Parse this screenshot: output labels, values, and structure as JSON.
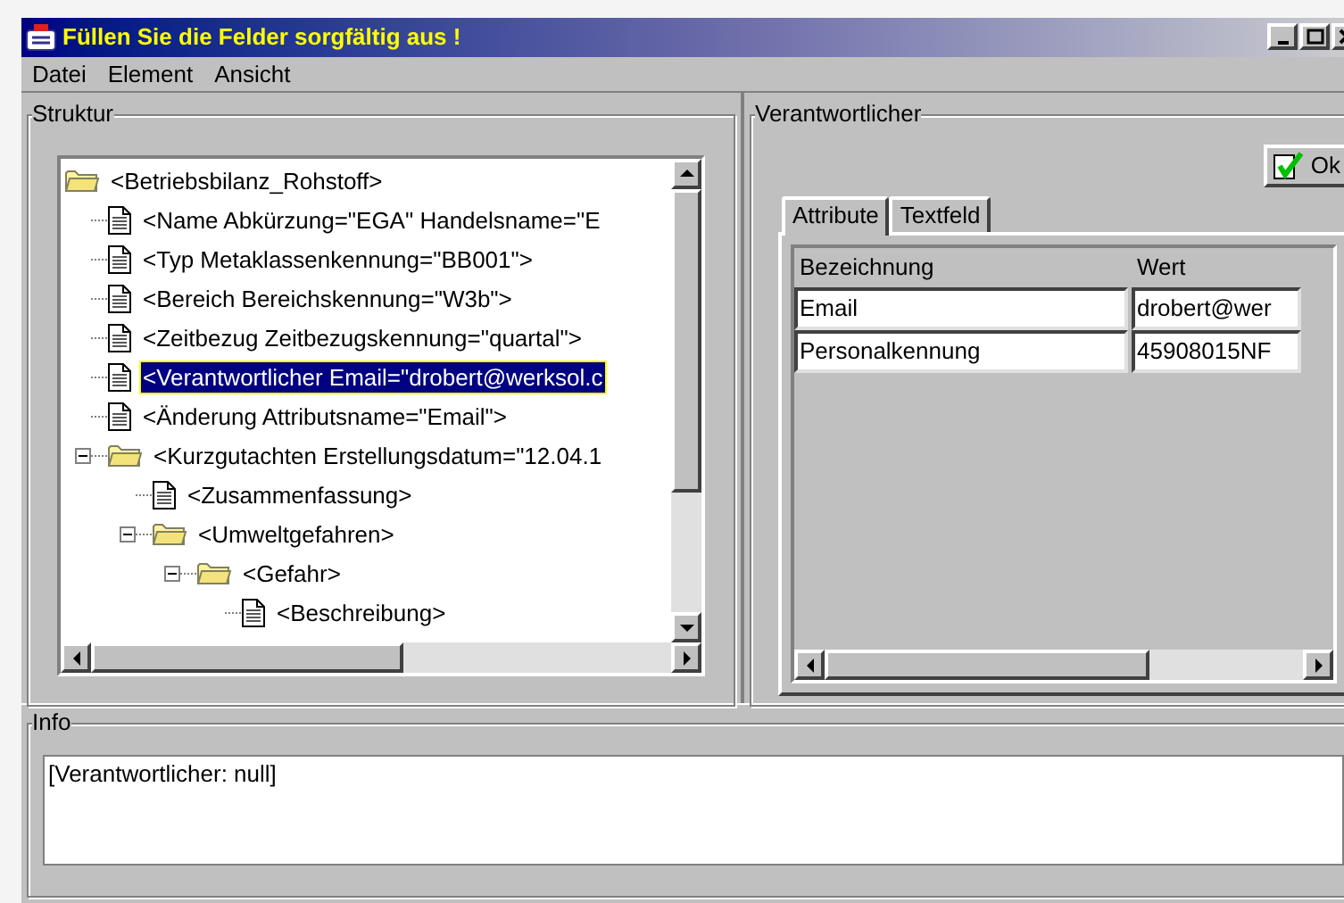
{
  "window": {
    "title": "Füllen Sie die Felder sorgfältig aus !"
  },
  "menu": [
    "Datei",
    "Element",
    "Ansicht"
  ],
  "structure": {
    "title": "Struktur",
    "tree": [
      {
        "kind": "folder",
        "label": "<Betriebsbilanz_Rohstoff>",
        "selected": false,
        "children": [
          {
            "kind": "document",
            "label": "<Name Abkürzung=\"EGA\" Handelsname=\"E",
            "selected": false
          },
          {
            "kind": "document",
            "label": "<Typ Metaklassenkennung=\"BB001\">",
            "selected": false
          },
          {
            "kind": "document",
            "label": "<Bereich Bereichskennung=\"W3b\">",
            "selected": false
          },
          {
            "kind": "document",
            "label": "<Zeitbezug Zeitbezugskennung=\"quartal\">",
            "selected": false
          },
          {
            "kind": "document",
            "label": "<Verantwortlicher Email=\"drobert@werksol.c",
            "selected": true
          },
          {
            "kind": "document",
            "label": "<Änderung Attributsname=\"Email\">",
            "selected": false
          },
          {
            "kind": "folder",
            "label": "<Kurzgutachten Erstellungsdatum=\"12.04.1",
            "selected": false,
            "expanded": true,
            "children": [
              {
                "kind": "document",
                "label": "<Zusammenfassung>",
                "selected": false
              },
              {
                "kind": "folder",
                "label": "<Umweltgefahren>",
                "selected": false,
                "expanded": true,
                "children": [
                  {
                    "kind": "folder",
                    "label": "<Gefahr>",
                    "selected": false,
                    "expanded": true,
                    "children": [
                      {
                        "kind": "document",
                        "label": "<Beschreibung>",
                        "selected": false
                      }
                    ]
                  }
                ]
              }
            ]
          }
        ]
      }
    ]
  },
  "detail": {
    "title": "Verantwortlicher",
    "ok_button": "Ok",
    "tabs": [
      {
        "label": "Attribute",
        "selected": true
      },
      {
        "label": "Textfeld",
        "selected": false
      }
    ],
    "table": {
      "columns": [
        "Bezeichnung",
        "Wert"
      ],
      "rows": [
        [
          "Email",
          "drobert@wer"
        ],
        [
          "Personalkennung",
          "45908015NF"
        ]
      ]
    }
  },
  "info": {
    "title": "Info",
    "text": "[Verantwortlicher: null]"
  }
}
